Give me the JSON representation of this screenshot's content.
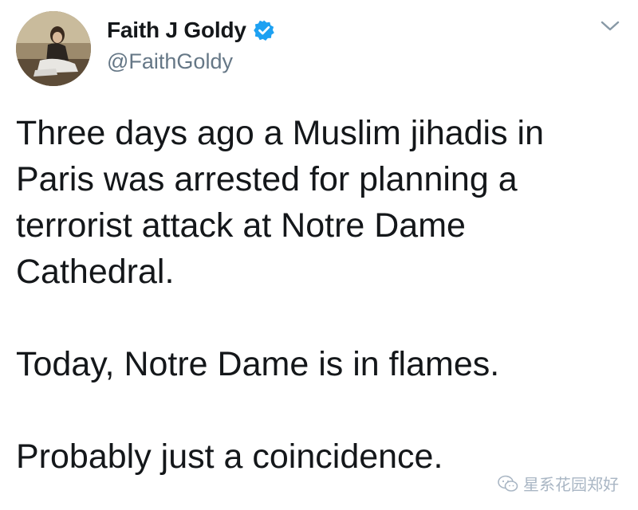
{
  "author": {
    "display_name": "Faith J Goldy",
    "handle": "@FaithGoldy",
    "verified": true
  },
  "tweet": {
    "paragraphs": [
      "Three days ago a Muslim jihadis in Paris was arrested for planning a terrorist attack at Notre Dame Cathedral.",
      "Today, Notre Dame is in flames.",
      "Probably just a coincidence."
    ]
  },
  "watermark": {
    "text": "星系花园郑好",
    "icon": "wechat-icon"
  },
  "colors": {
    "text": "#14171a",
    "secondary": "#657786",
    "verified_blue": "#1da1f2",
    "watermark": "#a9b6c4"
  },
  "icons": {
    "verified": "verified-badge-icon",
    "menu": "chevron-down-icon"
  }
}
